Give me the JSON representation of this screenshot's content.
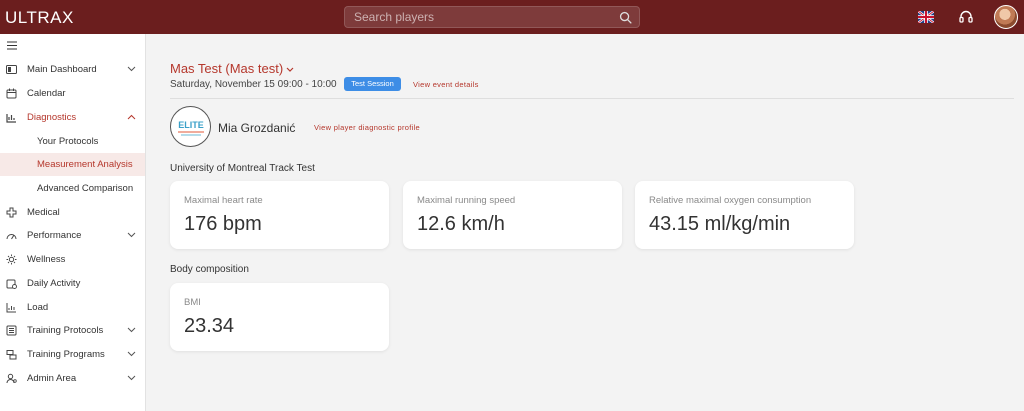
{
  "app": {
    "logo": "ULTRAX"
  },
  "search": {
    "placeholder": "Search players"
  },
  "sidebar": {
    "items": [
      {
        "label": "Main Dashboard"
      },
      {
        "label": "Calendar"
      },
      {
        "label": "Diagnostics"
      },
      {
        "label": "Your Protocols"
      },
      {
        "label": "Measurement Analysis"
      },
      {
        "label": "Advanced Comparison"
      },
      {
        "label": "Medical"
      },
      {
        "label": "Performance"
      },
      {
        "label": "Wellness"
      },
      {
        "label": "Daily Activity"
      },
      {
        "label": "Load"
      },
      {
        "label": "Training Protocols"
      },
      {
        "label": "Training Programs"
      },
      {
        "label": "Admin Area"
      }
    ]
  },
  "event": {
    "title": "Mas Test (Mas test)",
    "date": "Saturday, November 15 09:00 - 10:00",
    "badge": "Test Session",
    "details_link": "View event details"
  },
  "player": {
    "name": "Mia Grozdanić",
    "profile_link": "View player diagnostic profile",
    "logo_text": "ELITE"
  },
  "sections": [
    {
      "title": "University of Montreal Track Test",
      "metrics": [
        {
          "label": "Maximal heart rate",
          "value": "176 bpm"
        },
        {
          "label": "Maximal running speed",
          "value": "12.6 km/h"
        },
        {
          "label": "Relative maximal oxygen consumption",
          "value": "43.15 ml/kg/min"
        }
      ]
    },
    {
      "title": "Body composition",
      "metrics": [
        {
          "label": "BMI",
          "value": "23.34"
        }
      ]
    }
  ],
  "colors": {
    "topbar": "#6b1e1e",
    "accent": "#b5372c",
    "badge": "#3d8de6"
  }
}
